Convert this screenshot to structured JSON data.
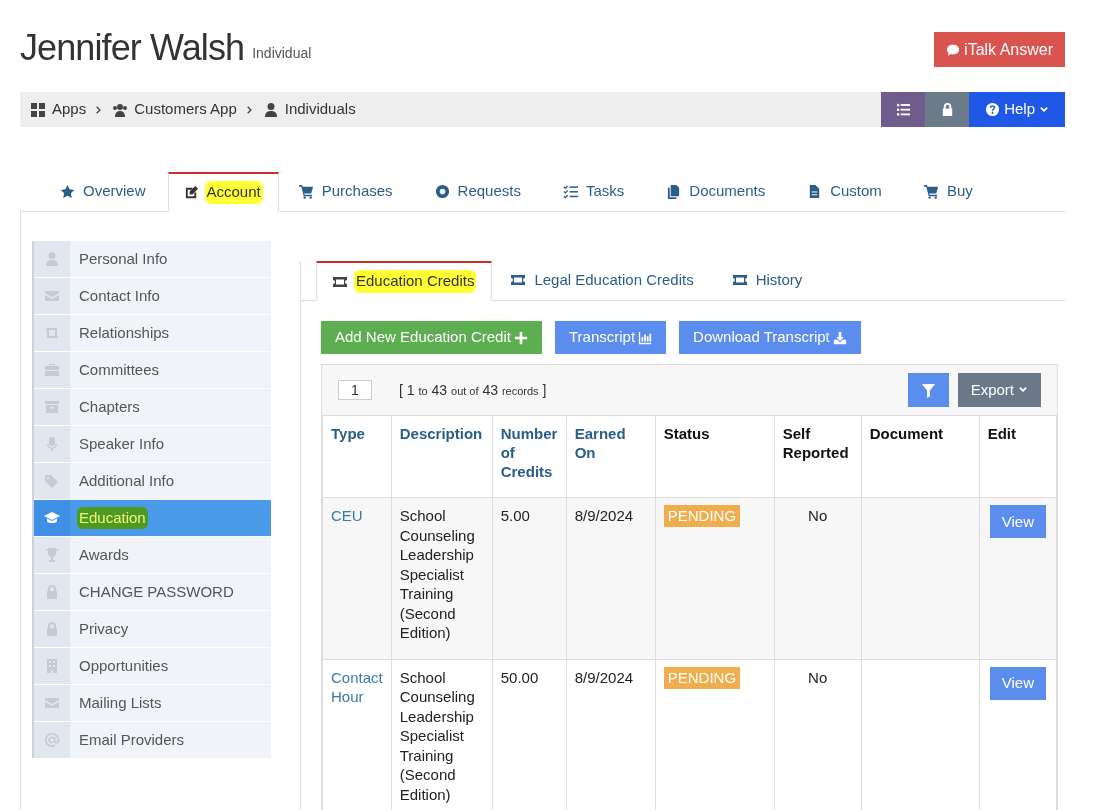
{
  "header": {
    "name": "Jennifer Walsh",
    "subtitle": "Individual",
    "chat_button": "iTalk Answer"
  },
  "breadcrumb": [
    "Apps",
    "Customers App",
    "Individuals"
  ],
  "toolbar": {
    "help": "Help"
  },
  "tabs": [
    {
      "label": "Overview",
      "selected": false
    },
    {
      "label": "Account",
      "selected": true,
      "color": "#ffff33"
    },
    {
      "label": "Purchases",
      "selected": false
    },
    {
      "label": "Requests",
      "selected": false
    },
    {
      "label": "Tasks",
      "selected": false
    },
    {
      "label": "Documents",
      "selected": false
    },
    {
      "label": "Custom",
      "selected": false
    },
    {
      "label": "Buy",
      "selected": false
    }
  ],
  "sidebar": {
    "items": [
      {
        "label": "Personal Info",
        "selected": false
      },
      {
        "label": "Contact Info",
        "selected": false
      },
      {
        "label": "Relationships",
        "selected": false
      },
      {
        "label": "Committees",
        "selected": false
      },
      {
        "label": "Chapters",
        "selected": false
      },
      {
        "label": "Speaker Info",
        "selected": false
      },
      {
        "label": "Additional Info",
        "selected": false
      },
      {
        "label": "Education",
        "selected": true,
        "color": "#4c9a22"
      },
      {
        "label": "Awards",
        "selected": false
      },
      {
        "label": "CHANGE PASSWORD",
        "selected": false
      },
      {
        "label": "Privacy",
        "selected": false
      },
      {
        "label": "Opportunities",
        "selected": false
      },
      {
        "label": "Mailing Lists",
        "selected": false
      },
      {
        "label": "Email Providers",
        "selected": false
      }
    ]
  },
  "sub_tabs": [
    {
      "label": "Education Credits",
      "selected": true,
      "color": "#ffff33"
    },
    {
      "label": "Legal Education Credits",
      "selected": false
    },
    {
      "label": "History",
      "selected": false
    }
  ],
  "actions": [
    {
      "label": "Add New Education Credit",
      "kind": "add"
    },
    {
      "label": "Transcript",
      "kind": "chart"
    },
    {
      "label": "Download Transcript",
      "kind": "download"
    }
  ],
  "table": {
    "page": "1",
    "records": "[ 1 **to** 43 **out of** 43 **records** ]",
    "export": "Export",
    "columns": [
      "Type",
      "Description",
      "Number of Credits",
      "Earned On",
      "Status",
      "Self Reported",
      "Document",
      "Edit"
    ],
    "rows": [
      {
        "type": "CEU",
        "description": "School Counseling Leadership Specialist Training (Second Edition)",
        "credits": "5.00",
        "earned_on": "8/9/2024",
        "status": "PENDING",
        "self_reported": "No",
        "action": "View"
      },
      {
        "type": "Contact Hour",
        "description": "School Counseling Leadership Specialist Training (Second Edition)",
        "credits": "50.00",
        "earned_on": "8/9/2024",
        "status": "PENDING",
        "self_reported": "No",
        "action": "View"
      }
    ]
  }
}
